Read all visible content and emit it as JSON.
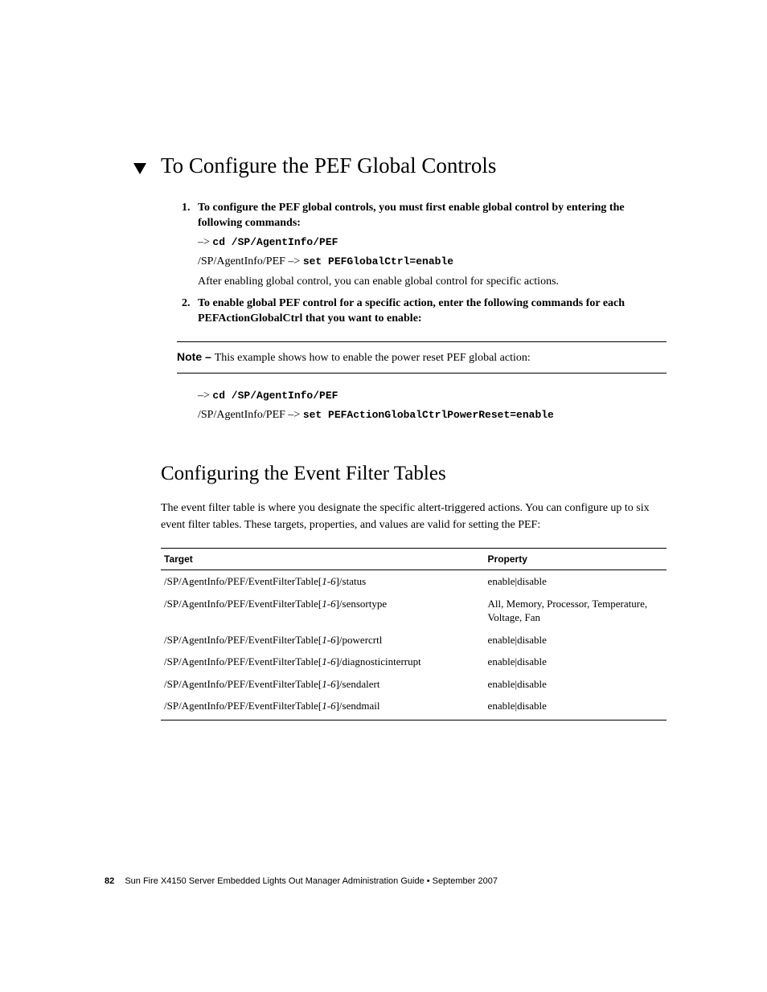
{
  "heading1": "To Configure the PEF Global Controls",
  "steps": [
    {
      "text": "To configure the PEF global controls, you must first enable global control by entering the following commands:",
      "cmd_prefix": "–> ",
      "cmd": "cd /SP/AgentInfo/PEF",
      "line2_prefix": "/SP/AgentInfo/PEF –> ",
      "line2_cmd": "set PEFGlobalCtrl=enable",
      "after": "After enabling global control, you can enable global control for specific actions."
    },
    {
      "text": "To enable global PEF control for a specific action, enter the following commands for each PEFActionGlobalCtrl that you want to enable:"
    }
  ],
  "note_label": "Note – ",
  "note_text": "This example shows how to enable the power reset PEF global action:",
  "cmd2_prefix": "–> ",
  "cmd2": "cd /SP/AgentInfo/PEF",
  "cmd2b_prefix": "/SP/AgentInfo/PEF –> ",
  "cmd2b": "set PEFActionGlobalCtrlPowerReset=enable",
  "heading2": "Configuring the Event Filter Tables",
  "para2": "The event filter table is where you designate the specific altert-triggered actions. You can configure up to six event filter tables. These targets, properties, and values are valid for setting the PEF:",
  "table": {
    "headers": [
      "Target",
      "Property"
    ],
    "rows": [
      {
        "targetPre": "/SP/AgentInfo/PEF/EventFilterTable[",
        "targetItal": "1-6",
        "targetPost": "]/status",
        "property": "enable|disable"
      },
      {
        "targetPre": "/SP/AgentInfo/PEF/EventFilterTable[",
        "targetItal": "1-6",
        "targetPost": "]/sensortype",
        "property": "All, Memory, Processor, Temperature, Voltage, Fan"
      },
      {
        "targetPre": "/SP/AgentInfo/PEF/EventFilterTable[",
        "targetItal": "1-6",
        "targetPost": "]/powercrtl",
        "property": "enable|disable"
      },
      {
        "targetPre": "/SP/AgentInfo/PEF/EventFilterTable[",
        "targetItal": "1-6",
        "targetPost": "]/diagnosticinterrupt",
        "property": "enable|disable"
      },
      {
        "targetPre": "/SP/AgentInfo/PEF/EventFilterTable[",
        "targetItal": "1-6",
        "targetPost": "]/sendalert",
        "property": "enable|disable"
      },
      {
        "targetPre": "/SP/AgentInfo/PEF/EventFilterTable[",
        "targetItal": "1-6",
        "targetPost": "]/sendmail",
        "property": "enable|disable"
      }
    ]
  },
  "footer": {
    "page": "82",
    "title": "Sun Fire X4150 Server Embedded Lights Out Manager Administration Guide • September 2007"
  }
}
